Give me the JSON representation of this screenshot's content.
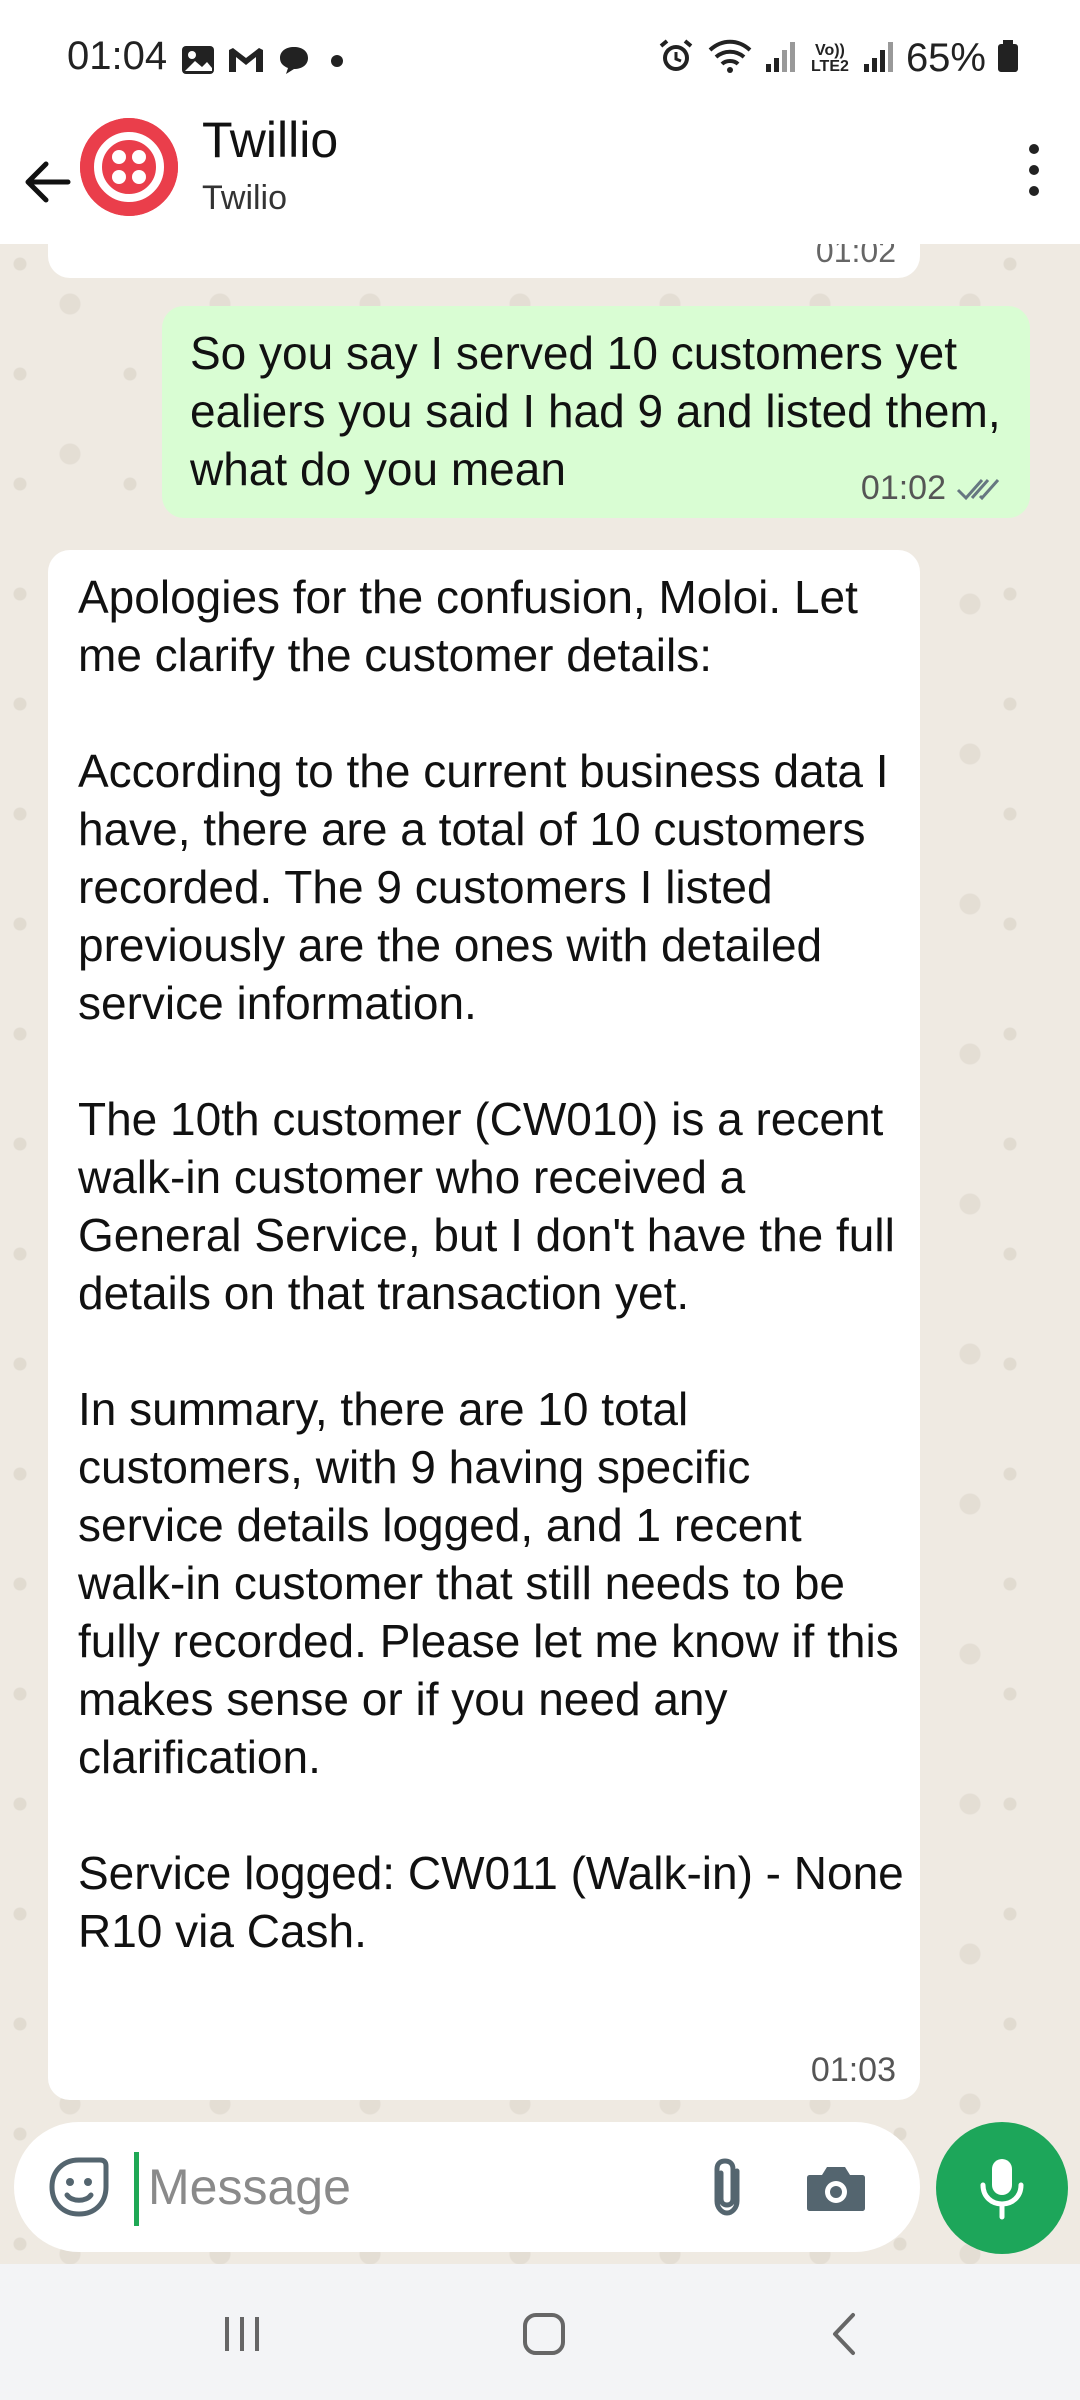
{
  "status_bar": {
    "time": "01:04",
    "battery": "65%",
    "left_icons": [
      "image-icon",
      "gmail-icon",
      "chat-bubble-icon",
      "dot-icon"
    ],
    "right_icons": [
      "alarm-icon",
      "wifi-icon",
      "signal-icon",
      "volte-icon",
      "signal-icon",
      "battery-icon"
    ],
    "volte_label": "Vo)) LTE2"
  },
  "header": {
    "title": "Twillio",
    "subtitle": "Twilio",
    "avatar_color": "#ea3e4b"
  },
  "messages": {
    "previous_partial": {
      "time": "01:02"
    },
    "user_message": {
      "text": "So you say I served 10 customers yet ealiers you said I had 9 and listed them, what do you mean",
      "time": "01:02",
      "status": "read"
    },
    "bot_message": {
      "paragraphs": [
        "Apologies for the confusion, Moloi. Let me clarify the customer details:",
        "According to the current business data I have, there are a total of 10 customers recorded. The 9 customers I listed previously are the ones with detailed service information.",
        "The 10th customer (CW010) is a recent walk-in customer who received a General Service, but I don't have the full details on that transaction yet.",
        "In summary, there are 10 total customers, with 9 having specific service details logged, and 1 recent walk-in customer that still needs to be fully recorded. Please let me know if this makes sense or if you need any clarification.",
        "Service logged: CW011 (Walk-in) - None R10 via Cash."
      ],
      "time": "01:03"
    }
  },
  "composer": {
    "placeholder": "Message"
  },
  "colors": {
    "accent_green": "#1da65a",
    "outgoing_bubble": "#d9fdd3",
    "chat_background": "#efeae2"
  }
}
